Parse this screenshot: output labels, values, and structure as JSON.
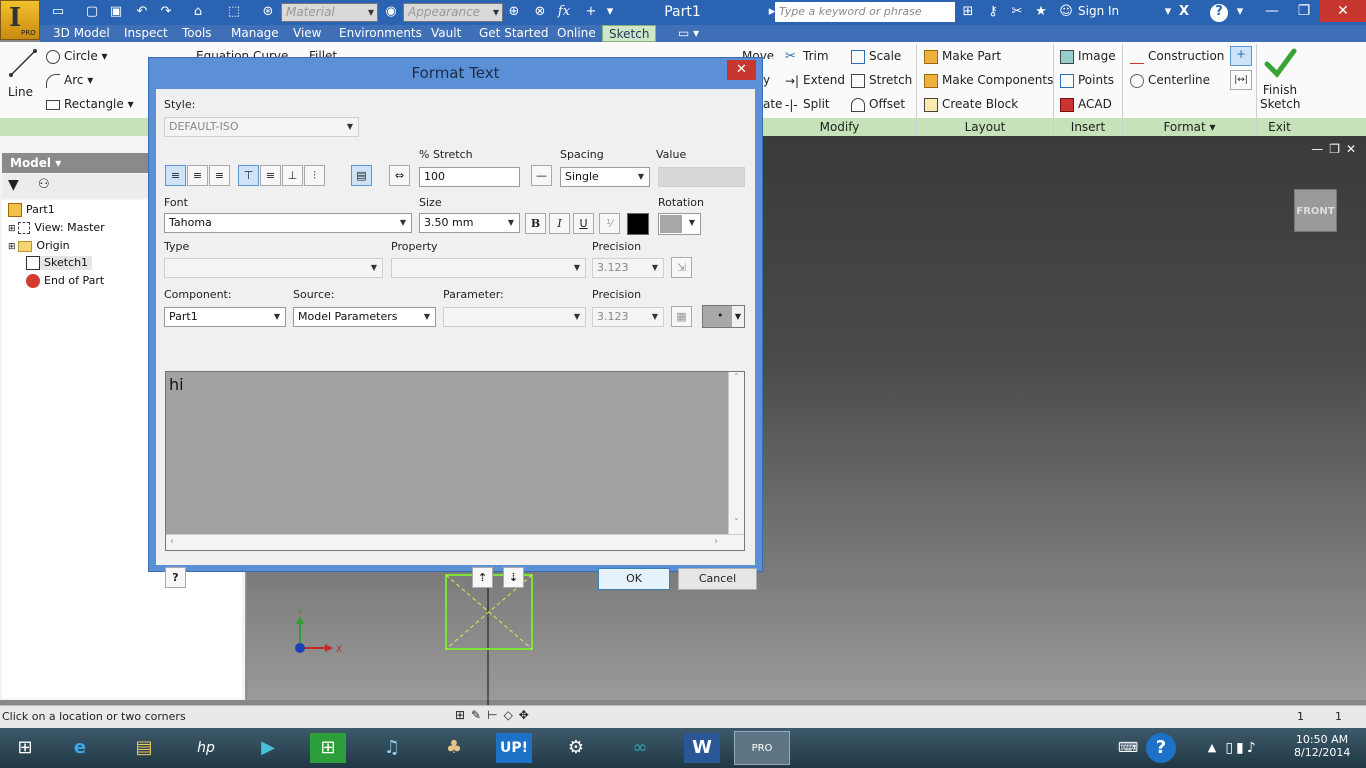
{
  "app": {
    "title": "Part1",
    "app_letter": "I",
    "edition": "PRO",
    "material_placeholder": "Material",
    "appearance_placeholder": "Appearance",
    "formula_icon_text": "fx",
    "search_placeholder": "Type a keyword or phrase",
    "sign_in": "Sign In",
    "help_glyph": "?"
  },
  "menu": {
    "tabs": [
      "3D Model",
      "Inspect",
      "Tools",
      "Manage",
      "View",
      "Environments",
      "Vault",
      "Get Started",
      "Online",
      "Sketch"
    ],
    "active_tab": "Sketch"
  },
  "ribbon": {
    "create": {
      "line": "Line",
      "circle": "Circle",
      "arc": "Arc",
      "rectangle": "Rectangle",
      "equation_curve": "Equation Curve",
      "fillet": "Fillet"
    },
    "modify": {
      "move": "Move",
      "copy": "y",
      "rotate": "ate",
      "trim": "Trim",
      "extend": "Extend",
      "split": "Split",
      "scale": "Scale",
      "stretch": "Stretch",
      "offset": "Offset"
    },
    "layout": {
      "make_part": "Make Part",
      "make_components": "Make Components",
      "create_block": "Create Block"
    },
    "insert": {
      "image": "Image",
      "points": "Points",
      "acad": "ACAD"
    },
    "format": {
      "construction": "Construction",
      "centerline": "Centerline"
    },
    "exit": {
      "finish_line1": "Finish",
      "finish_line2": "Sketch"
    },
    "panel_labels": {
      "modify": "Modify",
      "layout": "Layout",
      "insert": "Insert",
      "format": "Format ▾",
      "exit": "Exit"
    }
  },
  "browser": {
    "header": "Model ▾",
    "tree": [
      "Part1",
      "View: Master",
      "Origin",
      "Sketch1",
      "End of Part"
    ]
  },
  "viewcube": {
    "face": "FRONT"
  },
  "axes": {
    "x": "X",
    "y": "Y"
  },
  "status": {
    "prompt": "Click on a location or two corners",
    "count1": "1",
    "count2": "1"
  },
  "taskbar": {
    "time": "10:50 AM",
    "date": "8/12/2014",
    "up_label": "UP!",
    "hp_label": "hp",
    "pro_label": "PRO"
  },
  "dialog": {
    "title": "Format Text",
    "close_glyph": "✕",
    "style_label": "Style:",
    "style_value": "DEFAULT-ISO",
    "stretch_label": "% Stretch",
    "stretch_value": "100",
    "spacing_label": "Spacing",
    "spacing_value": "Single",
    "value_label": "Value",
    "font_label": "Font",
    "font_value": "Tahoma",
    "size_label": "Size",
    "size_value": "3.50 mm",
    "bold": "B",
    "italic": "I",
    "underline": "U",
    "rotation_label": "Rotation",
    "type_label": "Type",
    "property_label": "Property",
    "precision_label": "Precision",
    "precision_value1": "3.123",
    "component_label": "Component:",
    "component_value": "Part1",
    "source_label": "Source:",
    "source_value": "Model Parameters",
    "parameter_label": "Parameter:",
    "precision_label2": "Precision",
    "precision_value2": "3.123",
    "text_content": "hi",
    "help_glyph": "?",
    "ok": "OK",
    "cancel": "Cancel",
    "text_color": "#000000"
  },
  "colors": {
    "titlebar": "#2b63b3",
    "ribbon_panel": "#c5e2b8",
    "sketch_tab": "#cfe6c8",
    "close_red": "#c7372f",
    "sketch_green": "#7de33a"
  }
}
